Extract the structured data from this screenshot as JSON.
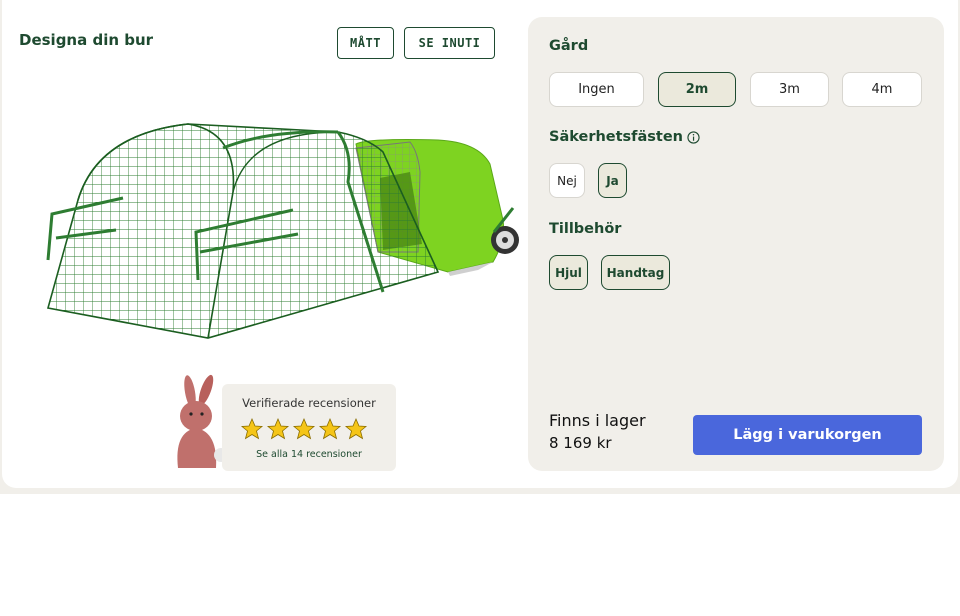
{
  "configurator": {
    "title": "Designa din bur",
    "view_buttons": {
      "dimensions": "MÅTT",
      "inside": "SE INUTI"
    }
  },
  "reviews": {
    "label": "Verifierade recensioner",
    "rating": 5,
    "max_rating": 5,
    "link": "Se alla 14 recensioner",
    "star_color": "#f5c518"
  },
  "options": {
    "run": {
      "title": "Gård",
      "items": [
        "Ingen",
        "2m",
        "3m",
        "4m"
      ],
      "selected": "2m"
    },
    "safety": {
      "title": "Säkerhetsfästen",
      "items": [
        "Nej",
        "Ja"
      ],
      "selected": "Ja"
    },
    "accessories": {
      "title": "Tillbehör",
      "items": [
        "Hjul",
        "Handtag"
      ],
      "selected": [
        "Hjul",
        "Handtag"
      ]
    }
  },
  "purchase": {
    "stock": "Finns i lager",
    "price": "8 169 kr",
    "cart_button": "Lägg i varukorgen"
  },
  "colors": {
    "accent": "#1e4a30",
    "cart_button": "#4a67dc",
    "coop_green": "#7ed321",
    "rabbit": "#c0706c"
  }
}
